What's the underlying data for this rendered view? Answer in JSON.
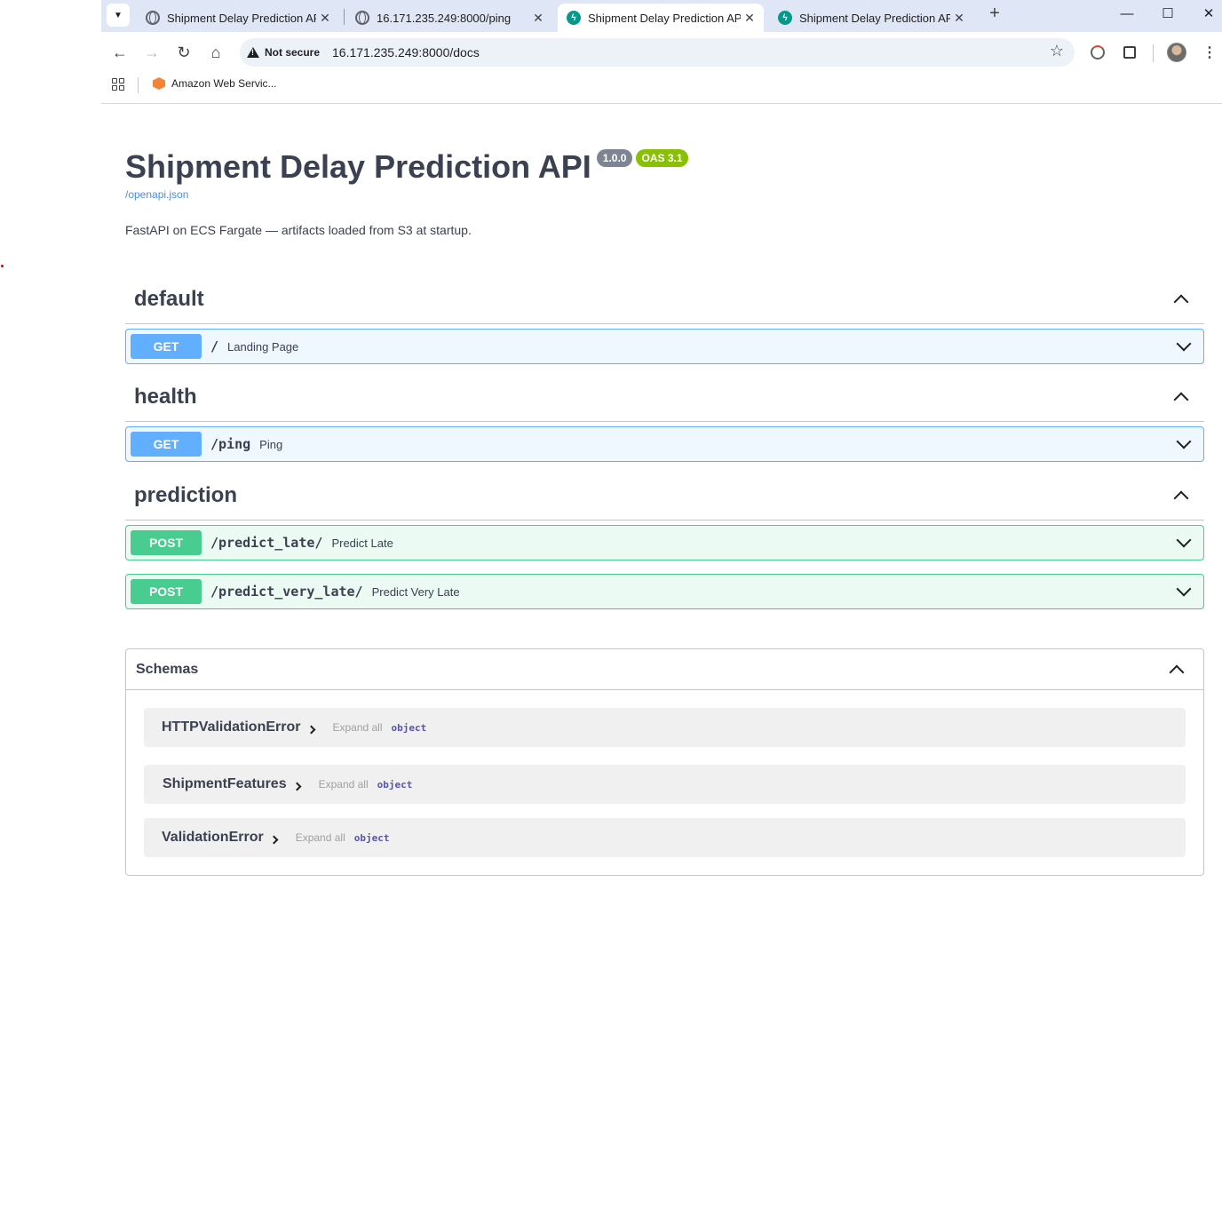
{
  "browser": {
    "tabs": [
      {
        "title": "Shipment Delay Prediction API",
        "icon": "globe-icon",
        "active": false
      },
      {
        "title": "16.171.235.249:8000/ping",
        "icon": "globe-icon",
        "active": false
      },
      {
        "title": "Shipment Delay Prediction API",
        "icon": "fastapi-icon",
        "active": true
      },
      {
        "title": "Shipment Delay Prediction API",
        "icon": "fastapi-icon",
        "active": false
      }
    ],
    "security_label": "Not secure",
    "url": "16.171.235.249:8000/docs",
    "bookmarks": [
      {
        "label": "Amazon Web Servic...",
        "icon": "aws-icon"
      }
    ]
  },
  "info": {
    "title": "Shipment Delay Prediction API",
    "version": "1.0.0",
    "oas": "OAS 3.1",
    "spec_link": "/openapi.json",
    "description": "FastAPI on ECS Fargate — artifacts loaded from S3 at startup."
  },
  "tags": [
    {
      "name": "default",
      "operations": [
        {
          "method": "GET",
          "path": "/",
          "summary": "Landing Page"
        }
      ]
    },
    {
      "name": "health",
      "operations": [
        {
          "method": "GET",
          "path": "/ping",
          "summary": "Ping"
        }
      ]
    },
    {
      "name": "prediction",
      "operations": [
        {
          "method": "POST",
          "path": "/predict_late/",
          "summary": "Predict Late"
        },
        {
          "method": "POST",
          "path": "/predict_very_late/",
          "summary": "Predict Very Late"
        }
      ]
    }
  ],
  "schemas": {
    "title": "Schemas",
    "expand_label": "Expand all",
    "models": [
      {
        "name": "HTTPValidationError",
        "type": "object"
      },
      {
        "name": "ShipmentFeatures",
        "type": "object"
      },
      {
        "name": "ValidationError",
        "type": "object"
      }
    ]
  },
  "colors": {
    "get": "#61affe",
    "post": "#49cc90",
    "version_badge": "#7d8492",
    "oas_badge": "#89bf04",
    "link": "#4990e2"
  }
}
